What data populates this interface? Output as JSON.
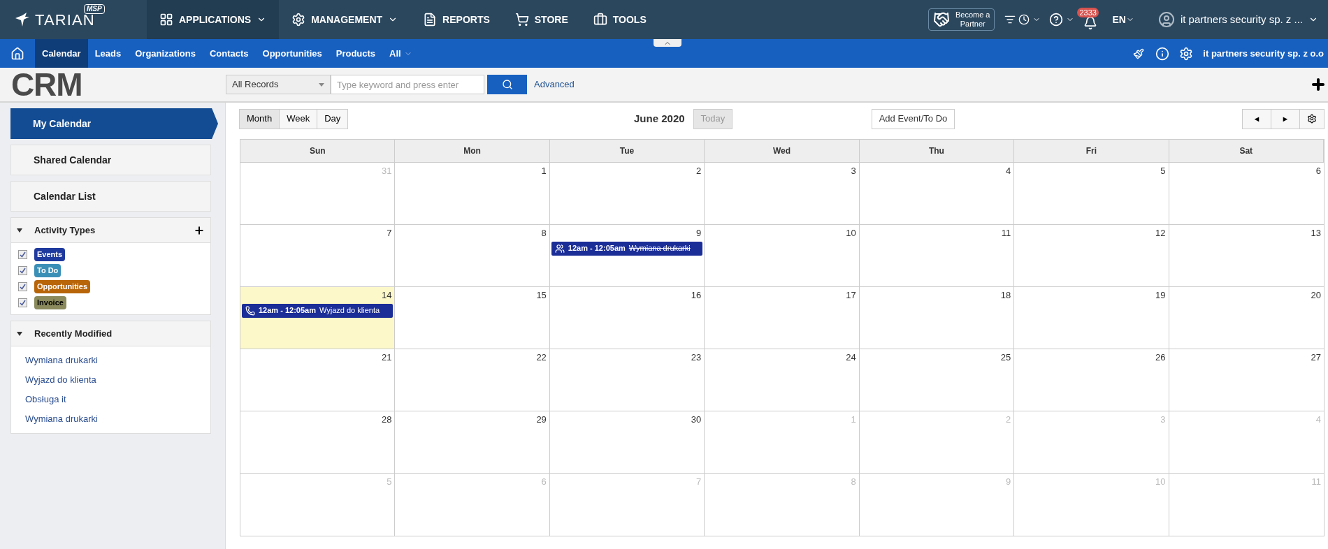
{
  "brand": {
    "name": "TARIAN",
    "badge": "MSP"
  },
  "top_menu": [
    {
      "kind": "grid",
      "label": "APPLICATIONS",
      "dropdown": true,
      "selected": true
    },
    {
      "kind": "gears",
      "label": "MANAGEMENT",
      "dropdown": true,
      "selected": false
    },
    {
      "kind": "report",
      "label": "REPORTS",
      "dropdown": false,
      "selected": false
    },
    {
      "kind": "cart",
      "label": "STORE",
      "dropdown": false,
      "selected": false
    },
    {
      "kind": "toolbox",
      "label": "TOOLS",
      "dropdown": false,
      "selected": false
    }
  ],
  "partner_button": {
    "line1": "Become a",
    "line2": "Partner"
  },
  "notifications": {
    "count": "2333"
  },
  "language": "EN",
  "account": "it partners security sp. z ...",
  "nav_tabs": [
    {
      "label": "Calendar",
      "selected": true
    },
    {
      "label": "Leads",
      "selected": false
    },
    {
      "label": "Organizations",
      "selected": false
    },
    {
      "label": "Contacts",
      "selected": false
    },
    {
      "label": "Opportunities",
      "selected": false
    },
    {
      "label": "Products",
      "selected": false
    },
    {
      "label": "All",
      "selected": false
    }
  ],
  "company": "it partners security sp. z o.o",
  "module_logo": "CRM",
  "search": {
    "filter": "All Records",
    "placeholder": "Type keyword and press enter",
    "advanced": "Advanced"
  },
  "sidebar": {
    "items": [
      {
        "label": "My Calendar",
        "selected": true
      },
      {
        "label": "Shared Calendar",
        "selected": false
      },
      {
        "label": "Calendar List",
        "selected": false
      }
    ],
    "activity_types": {
      "title": "Activity Types",
      "expanded": true,
      "items": [
        {
          "label": "Events",
          "checked": true,
          "color": "#1f3a9e"
        },
        {
          "label": "To Do",
          "checked": true,
          "color": "#3a8fb7"
        },
        {
          "label": "Opportunities",
          "checked": true,
          "color": "#b8650a"
        },
        {
          "label": "Invoice",
          "checked": true,
          "color": "#8a8a5c"
        }
      ]
    },
    "recently_modified": {
      "title": "Recently Modified",
      "expanded": true,
      "items": [
        "Wymiana drukarki",
        "Wyjazd do klienta",
        "Obsługa it",
        "Wymiana drukarki"
      ]
    }
  },
  "calendar": {
    "views": [
      {
        "label": "Month",
        "selected": true
      },
      {
        "label": "Week",
        "selected": false
      },
      {
        "label": "Day",
        "selected": false
      }
    ],
    "title": "June 2020",
    "today_button": "Today",
    "add_button": "Add Event/To Do",
    "prev": "◄",
    "next": "►",
    "weekdays": [
      "Sun",
      "Mon",
      "Tue",
      "Wed",
      "Thu",
      "Fri",
      "Sat"
    ],
    "days": [
      {
        "number": "31",
        "other_month": true,
        "today": false
      },
      {
        "number": "1",
        "other_month": false,
        "today": false
      },
      {
        "number": "2",
        "other_month": false,
        "today": false
      },
      {
        "number": "3",
        "other_month": false,
        "today": false
      },
      {
        "number": "4",
        "other_month": false,
        "today": false
      },
      {
        "number": "5",
        "other_month": false,
        "today": false
      },
      {
        "number": "6",
        "other_month": false,
        "today": false
      },
      {
        "number": "7",
        "other_month": false,
        "today": false
      },
      {
        "number": "8",
        "other_month": false,
        "today": false
      },
      {
        "number": "9",
        "other_month": false,
        "today": false,
        "events": [
          {
            "kind": "meeting",
            "time": "12am - 12:05am",
            "title": "Wymiana drukarki",
            "completed": true
          }
        ]
      },
      {
        "number": "10",
        "other_month": false,
        "today": false
      },
      {
        "number": "11",
        "other_month": false,
        "today": false
      },
      {
        "number": "12",
        "other_month": false,
        "today": false
      },
      {
        "number": "13",
        "other_month": false,
        "today": false
      },
      {
        "number": "14",
        "other_month": false,
        "today": true,
        "events": [
          {
            "kind": "call",
            "time": "12am - 12:05am",
            "title": "Wyjazd do klienta",
            "completed": false
          }
        ]
      },
      {
        "number": "15",
        "other_month": false,
        "today": false
      },
      {
        "number": "16",
        "other_month": false,
        "today": false
      },
      {
        "number": "17",
        "other_month": false,
        "today": false
      },
      {
        "number": "18",
        "other_month": false,
        "today": false
      },
      {
        "number": "19",
        "other_month": false,
        "today": false
      },
      {
        "number": "20",
        "other_month": false,
        "today": false
      },
      {
        "number": "21",
        "other_month": false,
        "today": false
      },
      {
        "number": "22",
        "other_month": false,
        "today": false
      },
      {
        "number": "23",
        "other_month": false,
        "today": false
      },
      {
        "number": "24",
        "other_month": false,
        "today": false
      },
      {
        "number": "25",
        "other_month": false,
        "today": false
      },
      {
        "number": "26",
        "other_month": false,
        "today": false
      },
      {
        "number": "27",
        "other_month": false,
        "today": false
      },
      {
        "number": "28",
        "other_month": false,
        "today": false
      },
      {
        "number": "29",
        "other_month": false,
        "today": false
      },
      {
        "number": "30",
        "other_month": false,
        "today": false
      },
      {
        "number": "1",
        "other_month": true,
        "today": false
      },
      {
        "number": "2",
        "other_month": true,
        "today": false
      },
      {
        "number": "3",
        "other_month": true,
        "today": false
      },
      {
        "number": "4",
        "other_month": true,
        "today": false
      },
      {
        "number": "5",
        "other_month": true,
        "today": false
      },
      {
        "number": "6",
        "other_month": true,
        "today": false
      },
      {
        "number": "7",
        "other_month": true,
        "today": false
      },
      {
        "number": "8",
        "other_month": true,
        "today": false
      },
      {
        "number": "9",
        "other_month": true,
        "today": false
      },
      {
        "number": "10",
        "other_month": true,
        "today": false
      },
      {
        "number": "11",
        "other_month": true,
        "today": false
      }
    ]
  }
}
